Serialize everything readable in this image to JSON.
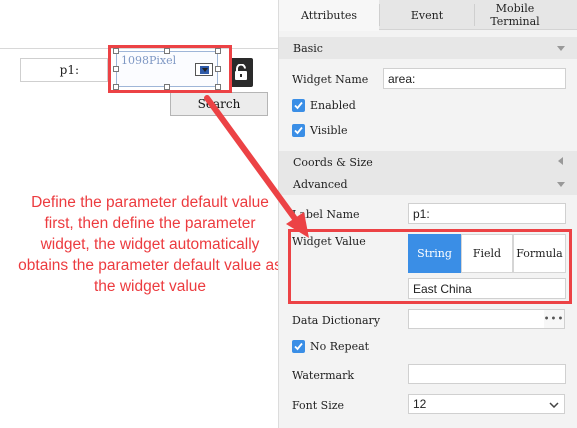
{
  "canvas": {
    "param_label": "p1:",
    "combo_placeholder": "1098Pixel",
    "search_button": "Search"
  },
  "annotation": {
    "text": "Define the parameter default value first, then define the parameter widget, the widget automatically obtains the parameter default value as the widget value"
  },
  "tabs": [
    {
      "label": "Attributes"
    },
    {
      "label": "Event"
    },
    {
      "label": "Mobile Terminal"
    }
  ],
  "sections": {
    "basic": "Basic",
    "coords": "Coords & Size",
    "advanced": "Advanced"
  },
  "basic": {
    "widget_name_label": "Widget Name",
    "widget_name_value": "area:",
    "enabled_label": "Enabled",
    "visible_label": "Visible"
  },
  "advanced": {
    "label_name_label": "Label Name",
    "label_name_value": "p1:",
    "widget_value_label": "Widget Value",
    "widget_value_types": [
      "String",
      "Field",
      "Formula"
    ],
    "widget_value_selected": "String",
    "widget_value_value": "East China",
    "data_dictionary_label": "Data Dictionary",
    "data_dictionary_value": "",
    "no_repeat_label": "No Repeat",
    "watermark_label": "Watermark",
    "watermark_value": "",
    "font_size_label": "Font Size",
    "font_size_value": "12"
  },
  "colors": {
    "highlight_red": "#ec4245",
    "accent_blue": "#3a8ee6"
  }
}
